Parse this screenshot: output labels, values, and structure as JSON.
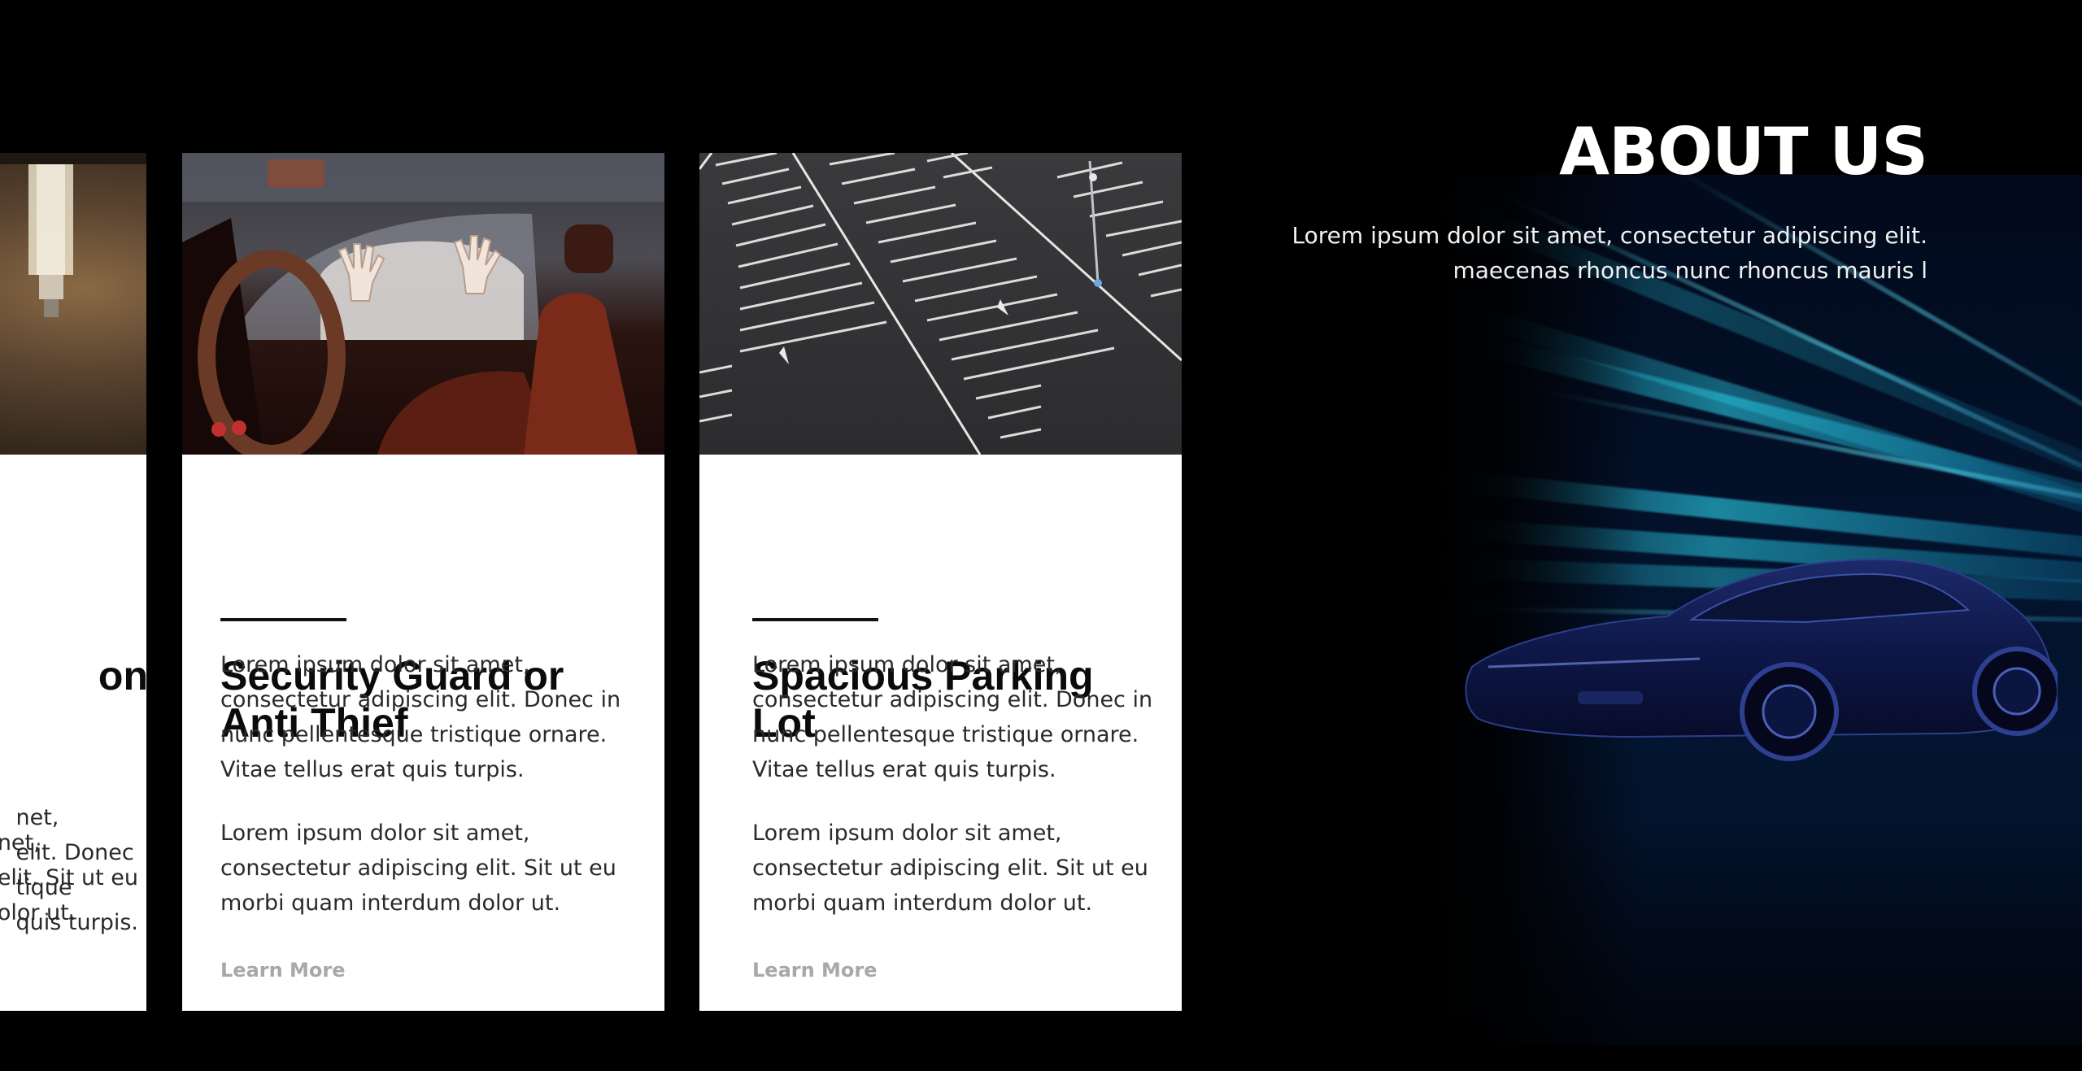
{
  "about": {
    "title": "ABOUT US",
    "text_line1": "Lorem ipsum dolor sit amet, consectetur adipiscing elit.",
    "text_line2": "maecenas rhoncus nunc rhoncus mauris l"
  },
  "cards": [
    {
      "title_visible": "on",
      "p1_lines": [
        "net,",
        "elit. Donec",
        "tique",
        "quis turpis."
      ],
      "p2_lines": [
        "net,",
        "elit. Sit ut eu",
        "olor ut."
      ],
      "image_icon": "ceiling-lamp-image"
    },
    {
      "title": "Security Guard or Anti Thief",
      "p1": "Lorem ipsum dolor sit amet, consectetur adipiscing elit. Donec in nunc pellentesque tristique ornare. Vitae tellus erat quis turpis.",
      "p2": "Lorem ipsum dolor sit amet, consectetur adipiscing elit. Sit ut eu morbi quam interdum dolor ut.",
      "link": "Learn More",
      "image_icon": "car-interior-thief-image"
    },
    {
      "title": "Spacious Parking Lot",
      "p1": "Lorem ipsum dolor sit amet, consectetur adipiscing elit. Donec in nunc pellentesque tristique ornare. Vitae tellus erat quis turpis.",
      "p2": "Lorem ipsum dolor sit amet, consectetur adipiscing elit. Sit ut eu morbi quam interdum dolor ut.",
      "link": "Learn More",
      "image_icon": "parking-lot-image"
    }
  ],
  "background": {
    "image_icon": "sports-car-light-streaks-image",
    "accent": "#1fb8d8"
  }
}
